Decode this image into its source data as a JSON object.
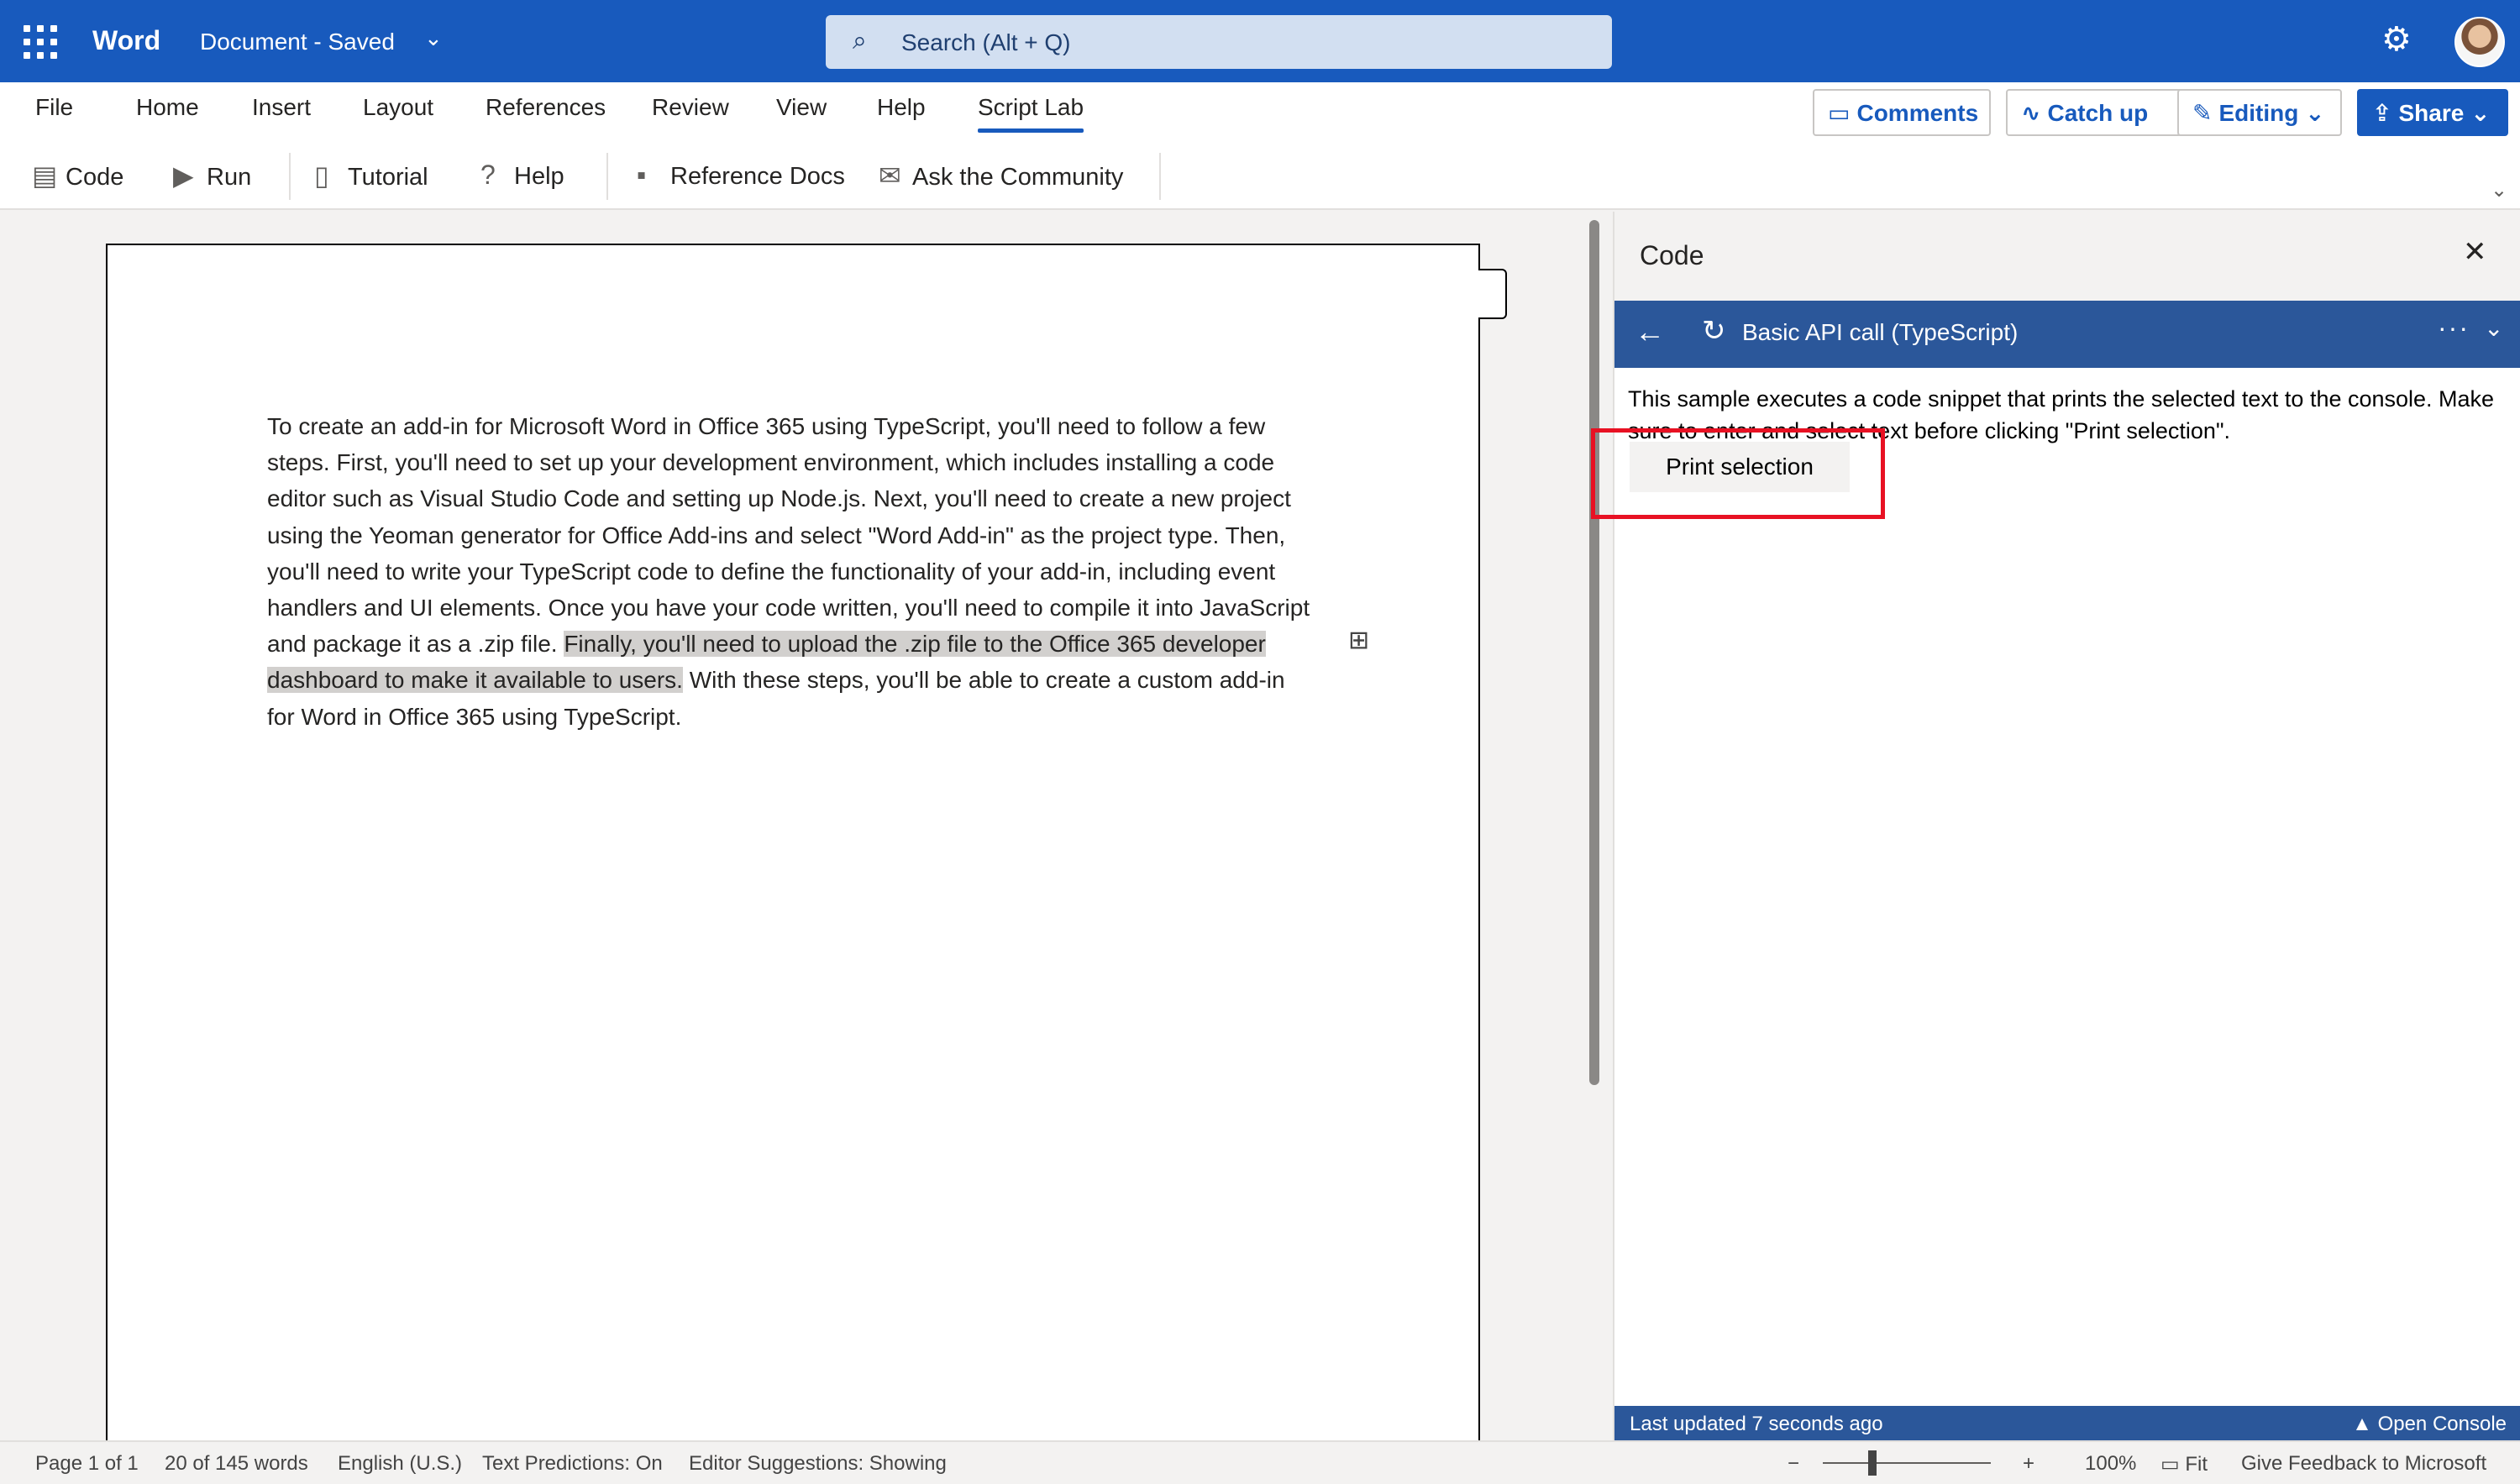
{
  "titlebar": {
    "app_name": "Word",
    "doc_name": "Document - Saved",
    "search_placeholder": "Search (Alt + Q)"
  },
  "menu": {
    "items": [
      "File",
      "Home",
      "Insert",
      "Layout",
      "References",
      "Review",
      "View",
      "Help",
      "Script Lab"
    ],
    "active": "Script Lab"
  },
  "top_buttons": {
    "comments": "Comments",
    "catch_up": "Catch up",
    "editing": "Editing",
    "share": "Share"
  },
  "ribbon": {
    "code": "Code",
    "run": "Run",
    "tutorial": "Tutorial",
    "help": "Help",
    "reference_docs": "Reference Docs",
    "ask_community": "Ask the Community"
  },
  "document": {
    "text_before": "To create an add-in for Microsoft Word in Office 365 using TypeScript, you'll need to follow a few steps. First, you'll need to set up your development environment, which includes installing a code editor such as Visual Studio Code and setting up Node.js. Next, you'll need to create a new project using the Yeoman generator for Office Add-ins and select \"Word Add-in\" as the project type. Then, you'll need to write your TypeScript code to define the functionality of your add-in, including event handlers and UI elements. Once you have your code written, you'll need to compile it into JavaScript and package it as a .zip file. ",
    "text_selected": "Finally, you'll need to upload the .zip file to the Office 365 developer dashboard to make it available to users.",
    "text_after": " With these steps, you'll be able to create a custom add-in for Word in Office 365 using TypeScript."
  },
  "pane": {
    "title": "Code",
    "snippet_title": "Basic API call (TypeScript)",
    "description": "This sample executes a code snippet that prints the selected text to the console. Make sure to enter and select text before clicking \"Print selection\".",
    "print_button": "Print selection",
    "last_updated": "Last updated 7 seconds ago",
    "open_console": "Open Console"
  },
  "status": {
    "page": "Page 1 of 1",
    "words": "20 of 145 words",
    "language": "English (U.S.)",
    "text_predictions": "Text Predictions: On",
    "editor_suggestions": "Editor Suggestions: Showing",
    "zoom": "100%",
    "fit": "Fit",
    "feedback": "Give Feedback to Microsoft"
  },
  "colors": {
    "brand_blue": "#185abd",
    "scriptlab_blue": "#2b579a",
    "highlight_red": "#e81123"
  },
  "icons": [
    "waffle-icon",
    "chevron-down-icon",
    "search-icon",
    "gear-icon",
    "comment-icon",
    "activity-icon",
    "pencil-icon",
    "share-icon",
    "code-icon",
    "run-icon",
    "book-icon",
    "help-icon",
    "docs-icon",
    "community-icon",
    "close-icon",
    "back-arrow-icon",
    "refresh-icon",
    "more-icon",
    "chevron-up-icon",
    "minus-icon",
    "plus-icon",
    "fit-icon"
  ]
}
